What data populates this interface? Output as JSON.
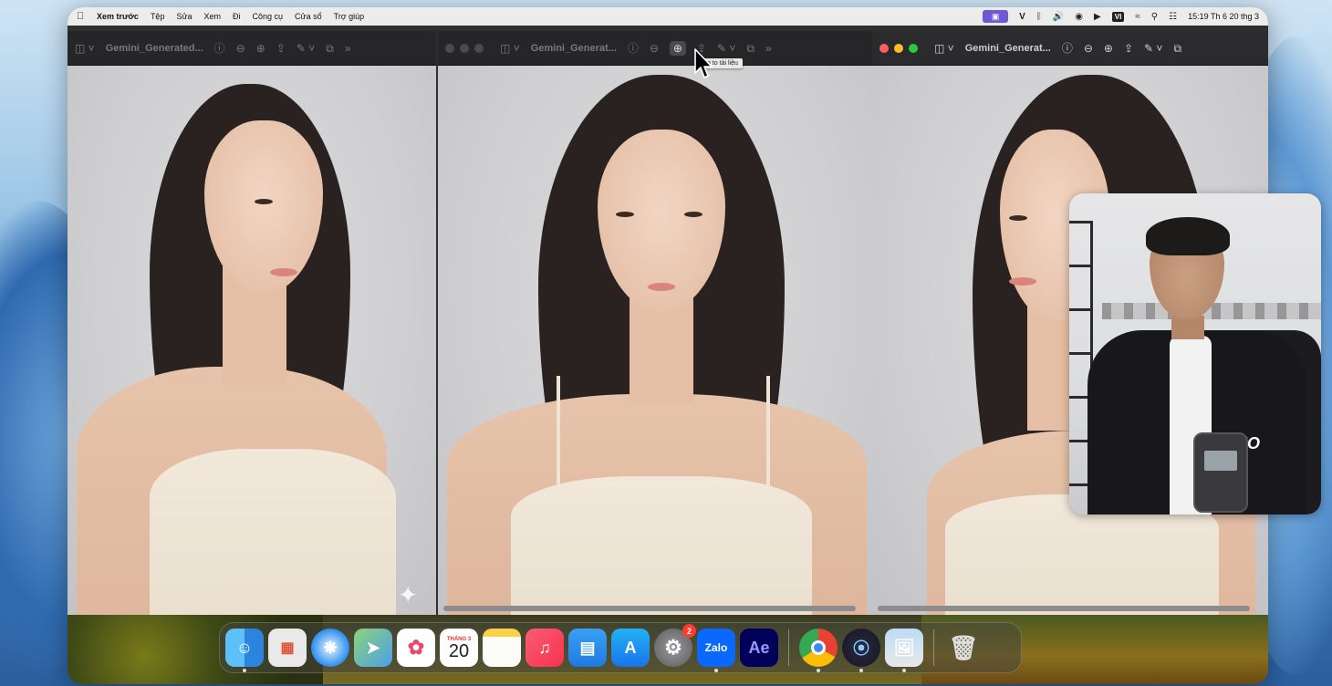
{
  "menubar": {
    "app_name": "Xem trước",
    "items": [
      "Tệp",
      "Sửa",
      "Xem",
      "Đi",
      "Công cụ",
      "Cửa sổ",
      "Trợ giúp"
    ],
    "status_icons": [
      "screen-record-icon",
      "v-icon",
      "bluetooth-icon",
      "volume-icon",
      "vpn-icon",
      "play-icon",
      "input-source",
      "wifi-icon",
      "spotlight-icon",
      "control-center-icon"
    ],
    "input_source": "VI",
    "clock": "15:19 Th 6 20 thg 3"
  },
  "windows": [
    {
      "title": "Gemini_Generated...",
      "active": false
    },
    {
      "title": "Gemini_Generat...",
      "active": false
    },
    {
      "title": "Gemini_Generat...",
      "active": true
    }
  ],
  "tooltip": {
    "text": "g to tài liệu"
  },
  "dock": {
    "apps": [
      {
        "name": "finder",
        "label": ""
      },
      {
        "name": "launchpad",
        "label": ""
      },
      {
        "name": "safari",
        "label": ""
      },
      {
        "name": "maps",
        "label": ""
      },
      {
        "name": "photos",
        "label": ""
      },
      {
        "name": "calendar",
        "label": ""
      },
      {
        "name": "notes",
        "label": ""
      },
      {
        "name": "music",
        "label": ""
      },
      {
        "name": "keynote",
        "label": ""
      },
      {
        "name": "app-store",
        "label": ""
      },
      {
        "name": "system-settings",
        "label": ""
      },
      {
        "name": "zalo",
        "label": "Zalo"
      },
      {
        "name": "after-effects",
        "label": "Ae"
      }
    ],
    "calendar_month": "THÁNG 3",
    "calendar_day": "20",
    "settings_badge": "2",
    "recent": [
      "chrome",
      "screen-recorder",
      "preview"
    ]
  },
  "webcam": {
    "logo_text": "MO"
  },
  "colors": {
    "accent": "#6e58d6",
    "menubar_bg": "#ececec",
    "toolbar_bg": "#262628"
  }
}
